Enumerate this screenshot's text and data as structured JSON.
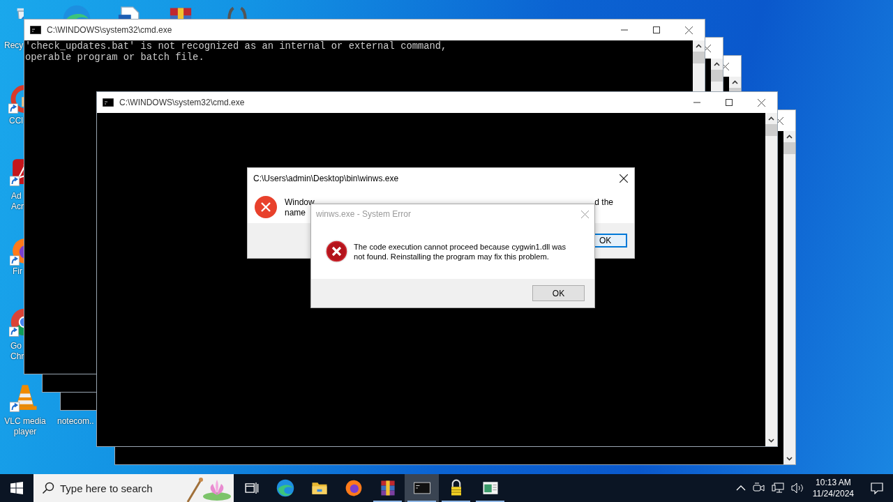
{
  "desktop_icons": [
    {
      "kind": "recycle",
      "label": "Recy"
    },
    {
      "kind": "edge"
    },
    {
      "kind": "document"
    },
    {
      "kind": "archive"
    },
    {
      "kind": "brackets"
    },
    {
      "kind": "ccleaner",
      "label": "CCl"
    },
    {
      "kind": "acrobat",
      "label": "Ad Acr"
    },
    {
      "kind": "firefox",
      "label": "Fir"
    },
    {
      "kind": "chrome",
      "label": "Go Chr"
    },
    {
      "kind": "vlc",
      "label": "VLC media player"
    },
    {
      "kind": "hidden",
      "label": "notecom.."
    }
  ],
  "windows": [
    {
      "kind": "console-hidden"
    },
    {
      "kind": "console-hidden"
    },
    {
      "kind": "console",
      "title": "C:\\WINDOWS\\system32\\cmd.exe",
      "lines": [
        "'check_updates.bat' is not recognized as an internal or external command,",
        "operable program or batch file."
      ]
    },
    {
      "kind": "console-hidden"
    },
    {
      "kind": "console",
      "title": "C:\\WINDOWS\\system32\\cmd.exe"
    }
  ],
  "error_dialog": {
    "title": "C:\\Users\\admin\\Desktop\\bin\\winws.exe",
    "message_visible_start": "Window",
    "message_visible_end": "d the",
    "message_line_2_visible": "name",
    "button": "OK"
  },
  "system_error_dialog": {
    "title": "winws.exe - System Error",
    "message": "The code execution cannot proceed because cygwin1.dll was not found. Reinstalling the program may fix this problem.",
    "button": "OK"
  },
  "taskbar": {
    "search_placeholder": "Type here to search",
    "apps": [
      {
        "kind": "task-view",
        "running": false,
        "selected": false
      },
      {
        "kind": "edge",
        "running": false,
        "selected": false
      },
      {
        "kind": "folder",
        "running": false,
        "selected": false
      },
      {
        "kind": "firefox",
        "running": false,
        "selected": false
      },
      {
        "kind": "archive",
        "running": true,
        "selected": false
      },
      {
        "kind": "console",
        "running": true,
        "selected": true
      },
      {
        "kind": "lock",
        "running": true,
        "selected": false
      },
      {
        "kind": "app-window",
        "running": true,
        "selected": false
      }
    ],
    "clock": {
      "time": "10:13 AM",
      "date": "11/24/2024"
    }
  }
}
